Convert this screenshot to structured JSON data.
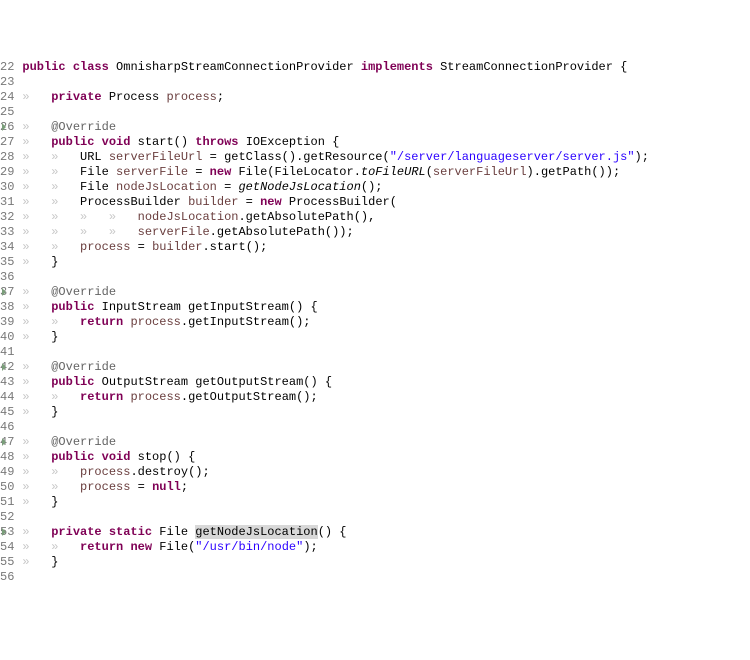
{
  "lines": [
    {
      "num": "22",
      "indent": 0,
      "tokens": [
        {
          "t": "public ",
          "c": "kw"
        },
        {
          "t": "class ",
          "c": "kw"
        },
        {
          "t": "OmnisharpStreamConnectionProvider"
        },
        {
          "t": " implements ",
          "c": "kw"
        },
        {
          "t": "StreamConnectionProvider {"
        }
      ]
    },
    {
      "num": "23",
      "indent": 0,
      "tokens": []
    },
    {
      "num": "24",
      "indent": 1,
      "tokens": [
        {
          "t": "private ",
          "c": "kw"
        },
        {
          "t": "Process "
        },
        {
          "t": "process",
          "c": "var"
        },
        {
          "t": ";"
        }
      ]
    },
    {
      "num": "25",
      "indent": 0,
      "tokens": []
    },
    {
      "num": "26",
      "indent": 1,
      "ov": true,
      "tokens": [
        {
          "t": "@Override",
          "c": "ann"
        }
      ]
    },
    {
      "num": "27",
      "indent": 1,
      "tokens": [
        {
          "t": "public ",
          "c": "kw"
        },
        {
          "t": "void ",
          "c": "kw"
        },
        {
          "t": "start() "
        },
        {
          "t": "throws ",
          "c": "kw"
        },
        {
          "t": "IOException {"
        }
      ]
    },
    {
      "num": "28",
      "indent": 2,
      "tokens": [
        {
          "t": "URL "
        },
        {
          "t": "serverFileUrl",
          "c": "var"
        },
        {
          "t": " = getClass().getResource("
        },
        {
          "t": "\"/server/languageserver/server.js\"",
          "c": "str"
        },
        {
          "t": ");"
        }
      ]
    },
    {
      "num": "29",
      "indent": 2,
      "tokens": [
        {
          "t": "File "
        },
        {
          "t": "serverFile",
          "c": "var"
        },
        {
          "t": " = "
        },
        {
          "t": "new ",
          "c": "kw"
        },
        {
          "t": "File(FileLocator."
        },
        {
          "t": "toFileURL",
          "c": "mth-italic"
        },
        {
          "t": "("
        },
        {
          "t": "serverFileUrl",
          "c": "var"
        },
        {
          "t": ").getPath());"
        }
      ]
    },
    {
      "num": "30",
      "indent": 2,
      "tokens": [
        {
          "t": "File "
        },
        {
          "t": "nodeJsLocation",
          "c": "var"
        },
        {
          "t": " = "
        },
        {
          "t": "getNodeJsLocation",
          "c": "mth-italic"
        },
        {
          "t": "();"
        }
      ]
    },
    {
      "num": "31",
      "indent": 2,
      "tokens": [
        {
          "t": "ProcessBuilder "
        },
        {
          "t": "builder",
          "c": "var"
        },
        {
          "t": " = "
        },
        {
          "t": "new ",
          "c": "kw"
        },
        {
          "t": "ProcessBuilder("
        }
      ]
    },
    {
      "num": "32",
      "indent": 4,
      "tokens": [
        {
          "t": "nodeJsLocation",
          "c": "var"
        },
        {
          "t": ".getAbsolutePath(),"
        }
      ]
    },
    {
      "num": "33",
      "indent": 4,
      "tokens": [
        {
          "t": "serverFile",
          "c": "var"
        },
        {
          "t": ".getAbsolutePath());"
        }
      ]
    },
    {
      "num": "34",
      "indent": 2,
      "tokens": [
        {
          "t": "process",
          "c": "var"
        },
        {
          "t": " = "
        },
        {
          "t": "builder",
          "c": "var"
        },
        {
          "t": ".start();"
        }
      ]
    },
    {
      "num": "35",
      "indent": 1,
      "tokens": [
        {
          "t": "}"
        }
      ]
    },
    {
      "num": "36",
      "indent": 0,
      "tokens": []
    },
    {
      "num": "37",
      "indent": 1,
      "ov": true,
      "tokens": [
        {
          "t": "@Override",
          "c": "ann"
        }
      ]
    },
    {
      "num": "38",
      "indent": 1,
      "tokens": [
        {
          "t": "public ",
          "c": "kw"
        },
        {
          "t": "InputStream getInputStream() {"
        }
      ]
    },
    {
      "num": "39",
      "indent": 2,
      "tokens": [
        {
          "t": "return ",
          "c": "kw"
        },
        {
          "t": "process",
          "c": "var"
        },
        {
          "t": ".getInputStream();"
        }
      ]
    },
    {
      "num": "40",
      "indent": 1,
      "tokens": [
        {
          "t": "}"
        }
      ]
    },
    {
      "num": "41",
      "indent": 0,
      "tokens": []
    },
    {
      "num": "42",
      "indent": 1,
      "ov": true,
      "tokens": [
        {
          "t": "@Override",
          "c": "ann"
        }
      ]
    },
    {
      "num": "43",
      "indent": 1,
      "tokens": [
        {
          "t": "public ",
          "c": "kw"
        },
        {
          "t": "OutputStream getOutputStream() {"
        }
      ]
    },
    {
      "num": "44",
      "indent": 2,
      "tokens": [
        {
          "t": "return ",
          "c": "kw"
        },
        {
          "t": "process",
          "c": "var"
        },
        {
          "t": ".getOutputStream();"
        }
      ]
    },
    {
      "num": "45",
      "indent": 1,
      "tokens": [
        {
          "t": "}"
        }
      ]
    },
    {
      "num": "46",
      "indent": 0,
      "tokens": []
    },
    {
      "num": "47",
      "indent": 1,
      "ov": true,
      "tokens": [
        {
          "t": "@Override",
          "c": "ann"
        }
      ]
    },
    {
      "num": "48",
      "indent": 1,
      "tokens": [
        {
          "t": "public ",
          "c": "kw"
        },
        {
          "t": "void ",
          "c": "kw"
        },
        {
          "t": "stop() {"
        }
      ]
    },
    {
      "num": "49",
      "indent": 2,
      "tokens": [
        {
          "t": "process",
          "c": "var"
        },
        {
          "t": ".destroy();"
        }
      ]
    },
    {
      "num": "50",
      "indent": 2,
      "tokens": [
        {
          "t": "process",
          "c": "var"
        },
        {
          "t": " = "
        },
        {
          "t": "null",
          "c": "kw"
        },
        {
          "t": ";"
        }
      ]
    },
    {
      "num": "51",
      "indent": 1,
      "tokens": [
        {
          "t": "}"
        }
      ]
    },
    {
      "num": "52",
      "indent": 0,
      "tokens": []
    },
    {
      "num": "53",
      "indent": 1,
      "ov": true,
      "tokens": [
        {
          "t": "private ",
          "c": "kw"
        },
        {
          "t": "static ",
          "c": "kw"
        },
        {
          "t": "File "
        },
        {
          "t": "getNodeJsLocation",
          "c": "highlight"
        },
        {
          "t": "() {"
        }
      ]
    },
    {
      "num": "54",
      "indent": 2,
      "tokens": [
        {
          "t": "return ",
          "c": "kw"
        },
        {
          "t": "new ",
          "c": "kw"
        },
        {
          "t": "File("
        },
        {
          "t": "\"/usr/bin/node\"",
          "c": "str"
        },
        {
          "t": ");"
        }
      ]
    },
    {
      "num": "55",
      "indent": 1,
      "tokens": [
        {
          "t": "}"
        }
      ]
    },
    {
      "num": "56",
      "indent": 0,
      "tokens": []
    }
  ],
  "whitespace_marker": "»   "
}
